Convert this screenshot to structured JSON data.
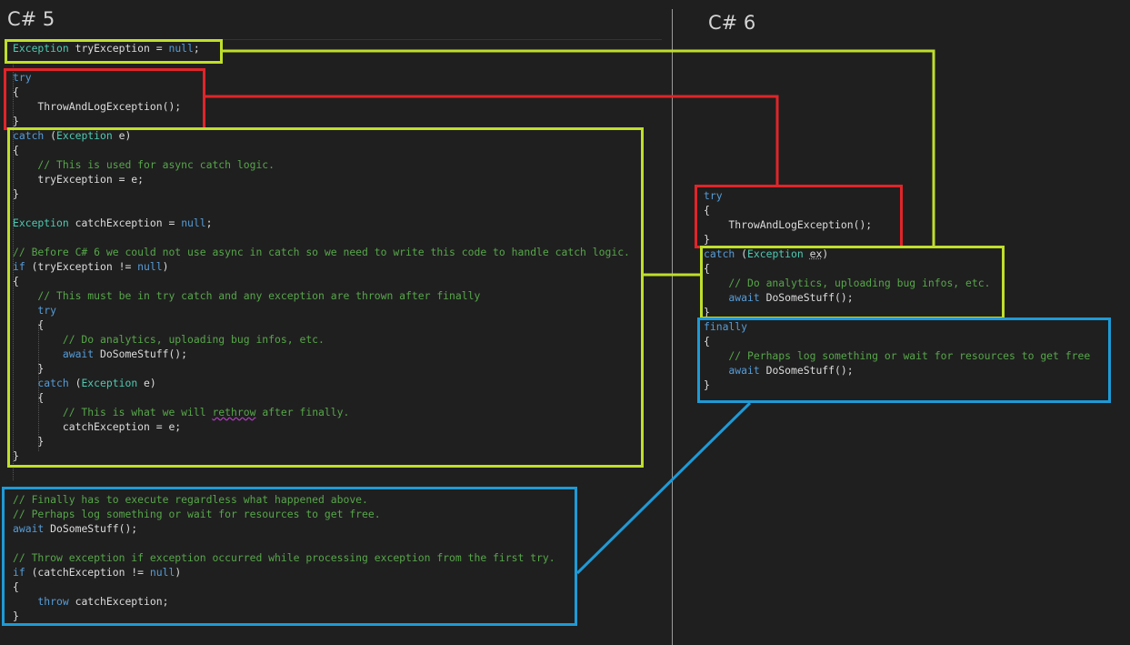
{
  "left_title": "C# 5",
  "right_title": "C# 6",
  "left": {
    "decl": [
      [
        [
          "ty",
          "Exception"
        ],
        [
          "tx",
          " tryException = "
        ],
        [
          "kw",
          "null"
        ],
        [
          "tx",
          ";"
        ]
      ]
    ],
    "try": [
      [
        [
          "kw",
          "try"
        ]
      ],
      [
        [
          "tx",
          "{"
        ]
      ],
      [
        [
          "tx",
          "    ThrowAndLogException();"
        ]
      ],
      [
        [
          "tx",
          "}"
        ]
      ]
    ],
    "catch": [
      [
        [
          "kw",
          "catch"
        ],
        [
          "tx",
          " ("
        ],
        [
          "ty",
          "Exception"
        ],
        [
          "tx",
          " e)"
        ]
      ],
      [
        [
          "tx",
          "{"
        ]
      ],
      [
        [
          "cm",
          "    // This is used for async catch logic."
        ]
      ],
      [
        [
          "tx",
          "    tryException = e;"
        ]
      ],
      [
        [
          "tx",
          "}"
        ]
      ],
      [],
      [
        [
          "ty",
          "Exception"
        ],
        [
          "tx",
          " catchException = "
        ],
        [
          "kw",
          "null"
        ],
        [
          "tx",
          ";"
        ]
      ],
      [],
      [
        [
          "cm",
          "// Before C# 6 we could not use async in catch so we need to write this code to handle catch logic."
        ]
      ],
      [
        [
          "kw",
          "if"
        ],
        [
          "tx",
          " (tryException != "
        ],
        [
          "kw",
          "null"
        ],
        [
          "tx",
          ")"
        ]
      ],
      [
        [
          "tx",
          "{"
        ]
      ],
      [
        [
          "cm",
          "    // This must be in try catch and any exception are thrown after finally"
        ]
      ],
      [
        [
          "kw",
          "    try"
        ]
      ],
      [
        [
          "tx",
          "    {"
        ]
      ],
      [
        [
          "cm",
          "        // Do analytics, uploading bug infos, etc."
        ]
      ],
      [
        [
          "kw",
          "        await"
        ],
        [
          "tx",
          " DoSomeStuff();"
        ]
      ],
      [
        [
          "tx",
          "    }"
        ]
      ],
      [
        [
          "kw",
          "    catch"
        ],
        [
          "tx",
          " ("
        ],
        [
          "ty",
          "Exception"
        ],
        [
          "tx",
          " e)"
        ]
      ],
      [
        [
          "tx",
          "    {"
        ]
      ],
      [
        [
          "cm",
          "        // This is what we will "
        ],
        [
          "cmsq",
          "rethrow"
        ],
        [
          "cm",
          " after finally."
        ]
      ],
      [
        [
          "tx",
          "        catchException = e;"
        ]
      ],
      [
        [
          "tx",
          "    }"
        ]
      ],
      [
        [
          "tx",
          "}"
        ]
      ]
    ],
    "finally": [
      [
        [
          "cm",
          "// Finally has to execute regardless what happened above."
        ]
      ],
      [
        [
          "cm",
          "// Perhaps log something or wait for resources to get free."
        ]
      ],
      [
        [
          "kw",
          "await"
        ],
        [
          "tx",
          " DoSomeStuff();"
        ]
      ],
      [],
      [
        [
          "cm",
          "// Throw exception if exception occurred while processing exception from the first try."
        ]
      ],
      [
        [
          "kw",
          "if"
        ],
        [
          "tx",
          " (catchException != "
        ],
        [
          "kw",
          "null"
        ],
        [
          "tx",
          ")"
        ]
      ],
      [
        [
          "tx",
          "{"
        ]
      ],
      [
        [
          "kw",
          "    throw"
        ],
        [
          "tx",
          " catchException;"
        ]
      ],
      [
        [
          "tx",
          "}"
        ]
      ]
    ]
  },
  "right": {
    "try": [
      [
        [
          "kw",
          "try"
        ]
      ],
      [
        [
          "tx",
          "{"
        ]
      ],
      [
        [
          "tx",
          "    ThrowAndLogException();"
        ]
      ],
      [
        [
          "tx",
          "}"
        ]
      ]
    ],
    "catch": [
      [
        [
          "kw",
          "catch"
        ],
        [
          "tx",
          " ("
        ],
        [
          "ty",
          "Exception"
        ],
        [
          "tx",
          " "
        ],
        [
          "dot",
          "ex"
        ],
        [
          "tx",
          ")"
        ]
      ],
      [
        [
          "tx",
          "{"
        ]
      ],
      [
        [
          "cm",
          "    // Do analytics, uploading bug infos, etc."
        ]
      ],
      [
        [
          "kw",
          "    await"
        ],
        [
          "tx",
          " DoSomeStuff();"
        ]
      ],
      [
        [
          "tx",
          "}"
        ]
      ]
    ],
    "finally": [
      [
        [
          "kw",
          "finally"
        ]
      ],
      [
        [
          "tx",
          "{"
        ]
      ],
      [
        [
          "cm",
          "    // Perhaps log something or wait for resources to get free"
        ]
      ],
      [
        [
          "kw",
          "    await"
        ],
        [
          "tx",
          " DoSomeStuff();"
        ]
      ],
      [
        [
          "tx",
          "}"
        ]
      ]
    ]
  },
  "colors": {
    "background": "#1f1f1f",
    "keyword": "#569cd6",
    "type": "#4ec9b0",
    "comment": "#57a64a",
    "text": "#dcdcdc",
    "box_green": "#bfdf2b",
    "box_red": "#e0252a",
    "box_blue": "#1e9ad6"
  }
}
